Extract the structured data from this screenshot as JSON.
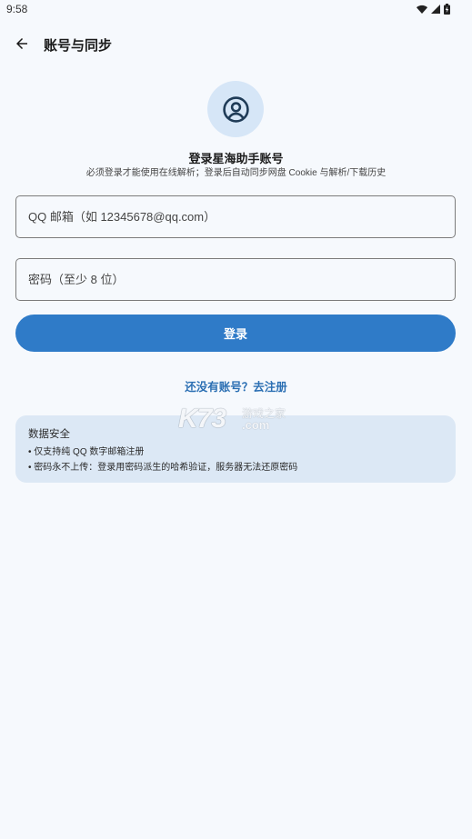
{
  "status_bar": {
    "time": "9:58",
    "icons": [
      "wifi-icon",
      "cell-signal-icon",
      "battery-charging-icon"
    ]
  },
  "app_bar": {
    "back_icon": "arrow-left-icon",
    "title": "账号与同步"
  },
  "login": {
    "avatar_icon": "user-circle-icon",
    "title": "登录星海助手账号",
    "subtitle": "必须登录才能使用在线解析；登录后自动同步网盘 Cookie 与解析/下载历史"
  },
  "form": {
    "email": {
      "placeholder": "QQ 邮箱（如 12345678@qq.com）"
    },
    "password": {
      "placeholder": "密码（至少 8 位）"
    },
    "submit_label": "登录"
  },
  "register_link": "还没有账号？去注册",
  "security": {
    "title": "数据安全",
    "items": [
      "• 仅支持纯 QQ 数字邮箱注册",
      "• 密码永不上传：登录用密码派生的哈希验证，服务器无法还原密码"
    ]
  },
  "watermark": {
    "brand": "K73",
    "cn": "游戏之家",
    "domain": ".com"
  },
  "colors": {
    "bg": "#f6f9fd",
    "accent": "#2f7bc8",
    "link": "#2b6fb3",
    "card": "#dce8f5",
    "avatar-bg": "#d6e6f7",
    "icon-dark": "#1f3b57"
  }
}
